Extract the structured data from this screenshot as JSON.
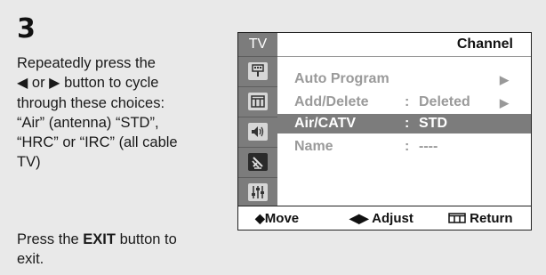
{
  "step": {
    "number": "3"
  },
  "instructions": {
    "line1": "Repeatedly press the",
    "line2_or": "or",
    "line2_after": "button to cycle",
    "line3": "through these choices:",
    "line4": "“Air” (antenna) “STD”,",
    "line5": "“HRC” or “IRC” (all cable",
    "line6": "TV)",
    "left_arrow_glyph": "◀",
    "right_arrow_glyph": "▶"
  },
  "exit_note": {
    "prefix": "Press the ",
    "button_name": "EXIT",
    "suffix": " button to",
    "line2": "exit."
  },
  "tv_menu": {
    "side_tabs": [
      {
        "label": "TV",
        "icon": "tv-tab"
      },
      {
        "icon": "antenna-icon"
      },
      {
        "icon": "picture-icon"
      },
      {
        "icon": "sound-icon"
      },
      {
        "icon": "channel-icon",
        "selected": true
      },
      {
        "icon": "setup-icon"
      }
    ],
    "title": "Channel",
    "items": [
      {
        "label": "Auto Program",
        "colon": "",
        "value": "",
        "arrow": "▶"
      },
      {
        "label": "Add/Delete",
        "colon": ":",
        "value": "Deleted",
        "arrow": "▶"
      },
      {
        "label": "Air/CATV",
        "colon": ":",
        "value": "STD",
        "arrow": "",
        "active": true
      },
      {
        "label": "Name",
        "colon": ":",
        "value": "----",
        "arrow": ""
      }
    ],
    "footer": {
      "move_symbol": "◆",
      "move_label": "Move",
      "adjust_symbol": "◀▶",
      "adjust_label": "Adjust",
      "return_label": "Return"
    }
  },
  "colors": {
    "background": "#e9e9e9",
    "sidebar": "#7c7c7c",
    "highlight": "#7c7c7c",
    "inactive_text": "#9a9a9a"
  }
}
